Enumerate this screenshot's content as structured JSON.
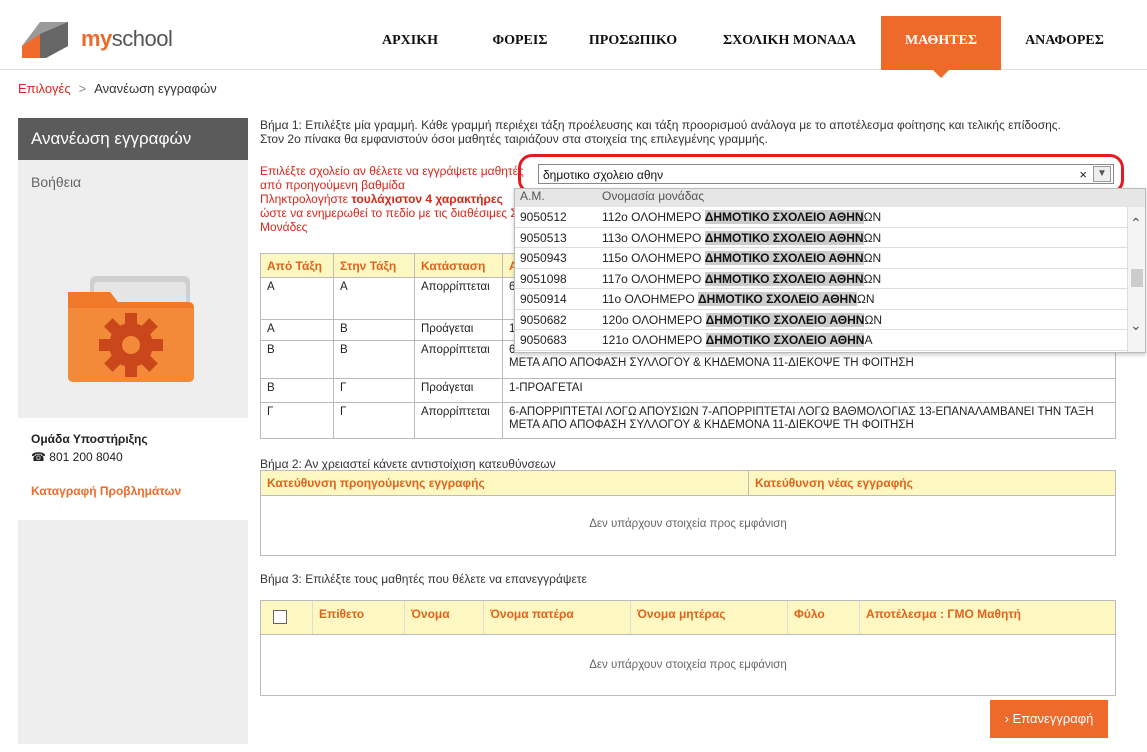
{
  "header": {
    "logo_text": "myschool",
    "nav": [
      {
        "label": "ΑΡΧΙΚΗ"
      },
      {
        "label": "ΦΟΡΕΙΣ"
      },
      {
        "label": "ΠΡΟΣΩΠΙΚΟ"
      },
      {
        "label": "ΣΧΟΛΙΚΗ ΜΟΝΑΔΑ"
      },
      {
        "label": "ΜΑΘΗΤΕΣ",
        "active": true
      },
      {
        "label": "ΑΝΑΦΟΡΕΣ"
      }
    ]
  },
  "breadcrumb": {
    "root": "Επιλογές",
    "sep": ">",
    "current": "Ανανέωση εγγραφών"
  },
  "sidebar": {
    "title": "Ανανέωση εγγραφών",
    "help": "Βοήθεια",
    "support_title": "Ομάδα Υποστήριξης",
    "phone": "801 200 8040",
    "report_link": "Καταγραφή Προβλημάτων"
  },
  "step1": {
    "line1": "Βήμα 1: Επιλέξτε μία γραμμή. Κάθε γραμμή περιέχει τάξη προέλευσης και τάξη προορισμού ανάλογα με το αποτέλεσμα φοίτησης και τελικής επίδοσης.",
    "line2": "Στον 2ο πίνακα θα εμφανιστούν όσοι μαθητές ταιριάζουν στα στοιχεία της επιλεγμένης γραμμής.",
    "hint_a": "Επιλέξτε σχολείο αν θέλετε να εγγράψετε μαθητές από προηγούμενη βαθμίδα",
    "hint_b_pre": "Πληκτρολογήστε ",
    "hint_b_bold": "τουλάχιστον 4 χαρακτήρες",
    "hint_b_post": " ώστε να ενημερωθεί το πεδίο με τις διαθέσιμες Σχ. Μονάδες",
    "combo_value": "δημοτικο σχολειο αθην",
    "clear": "×",
    "dropdown_arrow": "▼"
  },
  "dropdown": {
    "col1": "Α.Μ.",
    "col2": "Ονομασία μονάδας",
    "rows": [
      {
        "am": "9050512",
        "pre": "112ο ΟΛΟΗΜΕΡΟ ",
        "match": "ΔΗΜΟΤΙΚΟ ΣΧΟΛΕΙΟ ΑΘΗΝ",
        "post": "ΩΝ"
      },
      {
        "am": "9050513",
        "pre": "113ο ΟΛΟΗΜΕΡΟ ",
        "match": "ΔΗΜΟΤΙΚΟ ΣΧΟΛΕΙΟ ΑΘΗΝ",
        "post": "ΩΝ"
      },
      {
        "am": "9050943",
        "pre": "115ο ΟΛΟΗΜΕΡΟ ",
        "match": "ΔΗΜΟΤΙΚΟ ΣΧΟΛΕΙΟ ΑΘΗΝ",
        "post": "ΩΝ"
      },
      {
        "am": "9051098",
        "pre": "117ο ΟΛΟΗΜΕΡΟ ",
        "match": "ΔΗΜΟΤΙΚΟ ΣΧΟΛΕΙΟ ΑΘΗΝ",
        "post": "ΩΝ"
      },
      {
        "am": "9050914",
        "pre": "11ο ΟΛΟΗΜΕΡΟ ",
        "match": "ΔΗΜΟΤΙΚΟ ΣΧΟΛΕΙΟ ΑΘΗΝ",
        "post": "ΩΝ"
      },
      {
        "am": "9050682",
        "pre": "120ο ΟΛΟΗΜΕΡΟ ",
        "match": "ΔΗΜΟΤΙΚΟ ΣΧΟΛΕΙΟ ΑΘΗΝ",
        "post": "ΩΝ"
      },
      {
        "am": "9050683",
        "pre": "121ο ΟΛΟΗΜΕΡΟ ",
        "match": "ΔΗΜΟΤΙΚΟ ΣΧΟΛΕΙΟ ΑΘΗΝ",
        "post": "Α"
      }
    ]
  },
  "table1": {
    "headers": [
      "Από Τάξη",
      "Στην Τάξη",
      "Κατάσταση",
      "Α"
    ],
    "rows": [
      {
        "from": "Α",
        "to": "Α",
        "status": "Απορρίπτεται",
        "desc": "6"
      },
      {
        "from": "Α",
        "to": "Β",
        "status": "Προάγεται",
        "desc": "1"
      },
      {
        "from": "Β",
        "to": "Β",
        "status": "Απορρίπτεται",
        "desc": "6-ΑΠΟΡΡΙΠΤΕΤΑΙ ΛΟΓΩ ΑΠΟΥΣΙΩΝ 7-ΑΠΟΡΡΙΠΤΕΤΑΙ ΛΟΓΩ ΒΑΘΜΟΛΟΓΙΑΣ 13-ΕΠΑΝΑΛΑΜΒΑΝΕΙ ΤΗΝ ΤΑΞΗ ΜΕΤΑ ΑΠΟ ΑΠΟΦΑΣΗ ΣΥΛΛΟΓΟΥ & ΚΗΔΕΜΟΝΑ 11-ΔΙΕΚΟΨΕ ΤΗ ΦΟΙΤΗΣΗ"
      },
      {
        "from": "Β",
        "to": "Γ",
        "status": "Προάγεται",
        "desc": "1-ΠΡΟΑΓΕΤΑΙ"
      },
      {
        "from": "Γ",
        "to": "Γ",
        "status": "Απορρίπτεται",
        "desc": "6-ΑΠΟΡΡΙΠΤΕΤΑΙ ΛΟΓΩ ΑΠΟΥΣΙΩΝ 7-ΑΠΟΡΡΙΠΤΕΤΑΙ ΛΟΓΩ ΒΑΘΜΟΛΟΓΙΑΣ 13-ΕΠΑΝΑΛΑΜΒΑΝΕΙ ΤΗΝ ΤΑΞΗ ΜΕΤΑ ΑΠΟ ΑΠΟΦΑΣΗ ΣΥΛΛΟΓΟΥ & ΚΗΔΕΜΟΝΑ 11-ΔΙΕΚΟΨΕ ΤΗ ΦΟΙΤΗΣΗ"
      }
    ]
  },
  "step2": {
    "label": "Βήμα 2: Αν χρειαστεί κάνετε αντιστοίχιση κατευθύνσεων",
    "col1": "Κατεύθυνση προηγούμενης εγγραφής",
    "col2": "Κατεύθυνση νέας εγγραφής",
    "empty": "Δεν υπάρχουν στοιχεία προς εμφάνιση"
  },
  "step3": {
    "label": "Βήμα 3: Επιλέξτε τους μαθητές που θέλετε να επανεγγράψετε",
    "cols": [
      "Επίθετο",
      "Όνομα",
      "Όνομα πατέρα",
      "Όνομα μητέρας",
      "Φύλο",
      "Αποτέλεσμα : ΓΜΟ Μαθητή"
    ],
    "empty": "Δεν υπάρχουν στοιχεία προς εμφάνιση"
  },
  "renew_button": "Επανεγγραφή",
  "colors": {
    "accent": "#ee6a2b",
    "link_red": "#d8261a",
    "header_yellow": "#fdf7c2",
    "highlight_red": "#e31b23"
  }
}
